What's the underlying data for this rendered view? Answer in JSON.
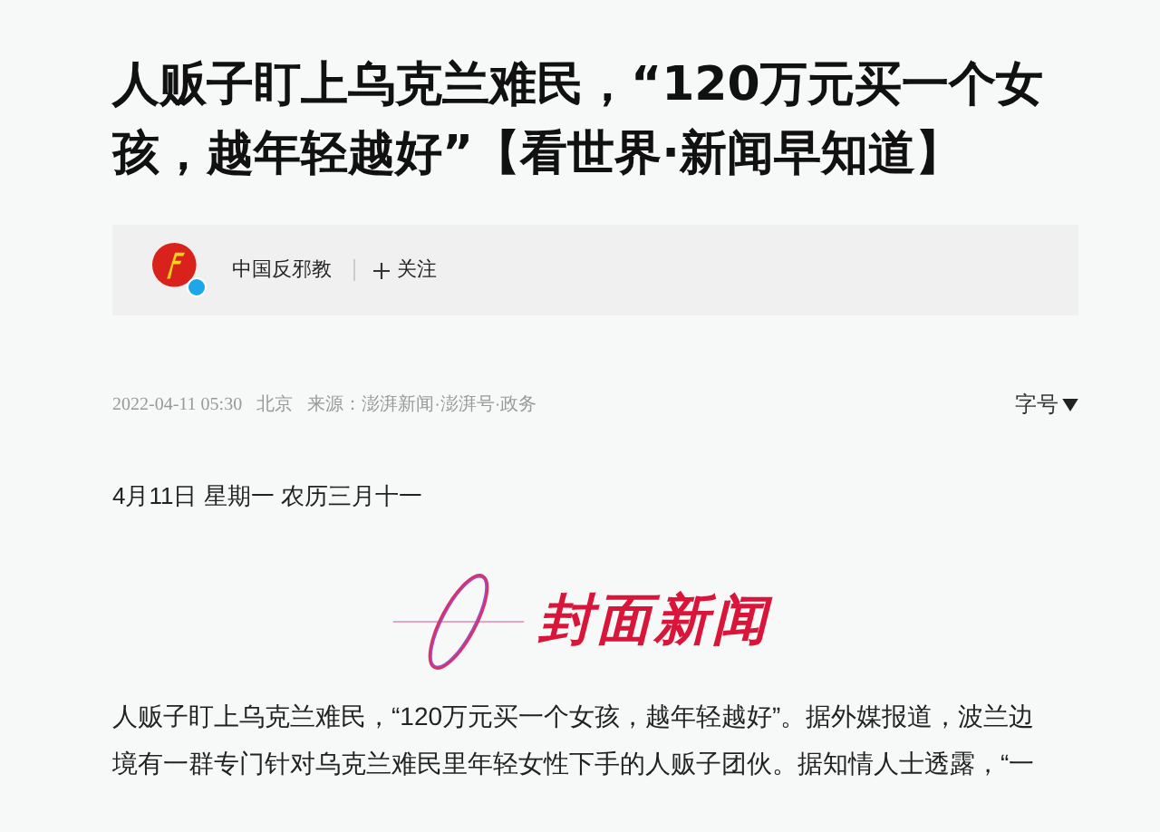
{
  "article": {
    "title": "人贩子盯上乌克兰难民，“120万元买一个女孩，越年轻越好”【看世界·新闻早知道】",
    "author": {
      "name": "中国反邪教",
      "verified": true,
      "follow_label": "关注"
    },
    "meta": {
      "datetime": "2022-04-11 05:30",
      "location": "北京",
      "source": "来源：澎湃新闻·澎湃号·政务",
      "font_size_label": "字号"
    },
    "date_line": "4月11日 星期一 农历三月十一",
    "logo_text": "封面新闻",
    "body": "人贩子盯上乌克兰难民，“120万元买一个女孩，越年轻越好”。据外媒报道，波兰边境有一群专门针对乌克兰难民里年轻女性下手的人贩子团伙。据知情人士透露，“一"
  }
}
